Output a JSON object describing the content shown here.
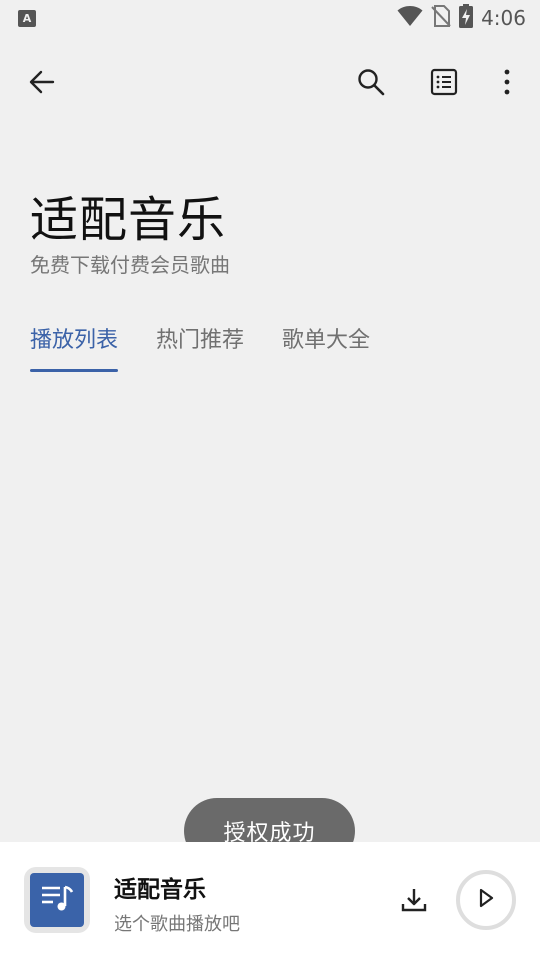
{
  "status_bar": {
    "notification_icon": "text-input-icon",
    "notification_glyph": "A",
    "icons": [
      "wifi-icon",
      "no-sim-icon",
      "battery-charging-icon"
    ],
    "time": "4:06"
  },
  "toolbar": {
    "back_icon": "arrow-back-icon",
    "search_icon": "search-icon",
    "list_icon": "list-icon",
    "more_icon": "more-vert-icon"
  },
  "header": {
    "title": "适配音乐",
    "subtitle": "免费下载付费会员歌曲"
  },
  "tabs": [
    {
      "label": "播放列表",
      "active": true
    },
    {
      "label": "热门推荐",
      "active": false
    },
    {
      "label": "歌单大全",
      "active": false
    }
  ],
  "toast": {
    "text": "授权成功"
  },
  "player": {
    "cover_icon": "playlist-music-icon",
    "title": "适配音乐",
    "subtitle": "选个歌曲播放吧",
    "download_icon": "download-icon",
    "play_icon": "play-icon"
  },
  "colors": {
    "accent": "#3b62a8",
    "background": "#f0f0f0",
    "toast_bg": "#6a6a6a"
  }
}
